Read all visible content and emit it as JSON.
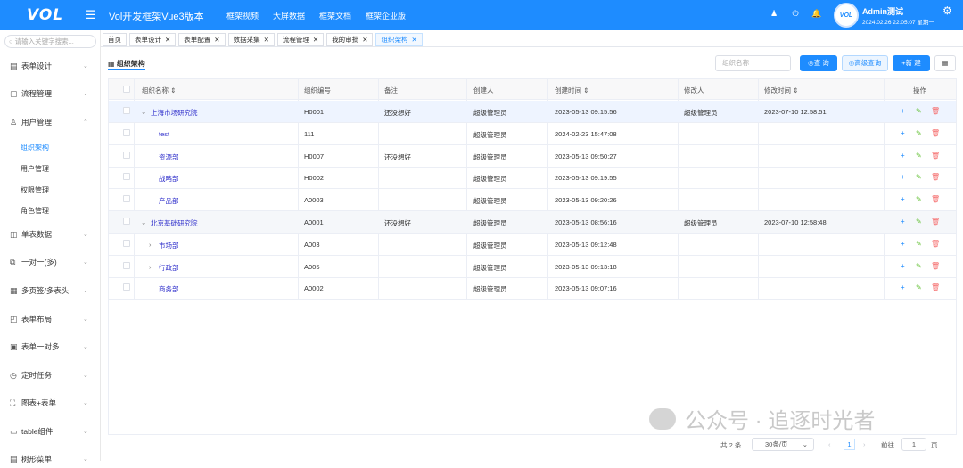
{
  "header": {
    "logo": "VOL",
    "menu_icon": "☰",
    "title": "Vol开发框架Vue3版本",
    "nav": [
      "框架视频",
      "大屏数据",
      "框架文档",
      "框架企业版"
    ],
    "icons": [
      "user-icon",
      "power-icon",
      "bell-icon"
    ],
    "icon_glyphs": [
      "♟",
      "⏻",
      "🔔"
    ],
    "avatar_text": "VOL",
    "user_name": "Admin测试",
    "user_date": "2024.02.26 22:05:07 星期一",
    "gear": "⚙"
  },
  "sidebar": {
    "search_placeholder": "请输入关键字搜索...",
    "menus": [
      {
        "label": "表单设计",
        "icon": "▤",
        "arrow": "⌄"
      },
      {
        "label": "流程管理",
        "icon": "▢",
        "arrow": "⌄"
      },
      {
        "label": "用户管理",
        "icon": "♙",
        "arrow": "⌃"
      },
      {
        "label": "单表数据",
        "icon": "◫",
        "arrow": "⌄"
      },
      {
        "label": "一对一(多)",
        "icon": "⧉",
        "arrow": "⌄"
      },
      {
        "label": "多页签/多表头",
        "icon": "▦",
        "arrow": "⌄"
      },
      {
        "label": "表单布局",
        "icon": "◰",
        "arrow": "⌄"
      },
      {
        "label": "表单一对多",
        "icon": "▣",
        "arrow": "⌄"
      },
      {
        "label": "定时任务",
        "icon": "◷",
        "arrow": "⌄"
      },
      {
        "label": "图表+表单",
        "icon": "⛶",
        "arrow": "⌄"
      },
      {
        "label": "table组件",
        "icon": "▭",
        "arrow": "⌄"
      },
      {
        "label": "树形菜单",
        "icon": "▤",
        "arrow": "⌄"
      }
    ],
    "submenu": [
      "组织架构",
      "用户管理",
      "权限管理",
      "角色管理"
    ]
  },
  "tabs": [
    {
      "label": "首页",
      "close": ""
    },
    {
      "label": "表单设计",
      "close": "✕"
    },
    {
      "label": "表单配置",
      "close": "✕"
    },
    {
      "label": "数据采集",
      "close": "✕"
    },
    {
      "label": "流程管理",
      "close": "✕"
    },
    {
      "label": "我的审批",
      "close": "✕"
    },
    {
      "label": "组织架构",
      "close": "✕"
    }
  ],
  "page": {
    "title": "▦ 组织架构",
    "search_placeholder": "组织名称",
    "btn_query": "◎查 询",
    "btn_advanced": "◎高级查询",
    "btn_new": "+新 建",
    "btn_grid": "▦"
  },
  "table": {
    "headers": [
      "组织名称 ⇕",
      "组织编号",
      "备注",
      "创建人",
      "创建时间 ⇕",
      "修改人",
      "修改时间 ⇕",
      "操作"
    ],
    "rows": [
      {
        "name": "上海市场研究院",
        "expander": "⌄",
        "code": "H0001",
        "remark": "还没想好",
        "creator": "超级管理员",
        "ctime": "2023-05-13 09:15:56",
        "modifier": "超级管理员",
        "mtime": "2023-07-10 12:58:51"
      },
      {
        "name": "test",
        "expander": "",
        "code": "111",
        "remark": "",
        "creator": "超级管理员",
        "ctime": "2024-02-23 15:47:08",
        "modifier": "",
        "mtime": ""
      },
      {
        "name": "资源部",
        "expander": "",
        "code": "H0007",
        "remark": "还没想好",
        "creator": "超级管理员",
        "ctime": "2023-05-13 09:50:27",
        "modifier": "",
        "mtime": ""
      },
      {
        "name": "战略部",
        "expander": "",
        "code": "H0002",
        "remark": "",
        "creator": "超级管理员",
        "ctime": "2023-05-13 09:19:55",
        "modifier": "",
        "mtime": ""
      },
      {
        "name": "产品部",
        "expander": "",
        "code": "A0003",
        "remark": "",
        "creator": "超级管理员",
        "ctime": "2023-05-13 09:20:26",
        "modifier": "",
        "mtime": ""
      },
      {
        "name": "北京基础研究院",
        "expander": "⌄",
        "code": "A0001",
        "remark": "还没想好",
        "creator": "超级管理员",
        "ctime": "2023-05-13 08:56:16",
        "modifier": "超级管理员",
        "mtime": "2023-07-10 12:58:48"
      },
      {
        "name": "市场部",
        "expander": "›",
        "code": "A003",
        "remark": "",
        "creator": "超级管理员",
        "ctime": "2023-05-13 09:12:48",
        "modifier": "",
        "mtime": ""
      },
      {
        "name": "行政部",
        "expander": "›",
        "code": "A005",
        "remark": "",
        "creator": "超级管理员",
        "ctime": "2023-05-13 09:13:18",
        "modifier": "",
        "mtime": ""
      },
      {
        "name": "商务部",
        "expander": "",
        "code": "A0002",
        "remark": "",
        "creator": "超级管理员",
        "ctime": "2023-05-13 09:07:16",
        "modifier": "",
        "mtime": ""
      }
    ],
    "action_glyphs": [
      "+",
      "✎",
      "🗑"
    ]
  },
  "pager": {
    "total": "共 2 条",
    "page_size": "30条/页",
    "page_size_arrow": "⌄",
    "prev": "‹",
    "current": "1",
    "next": "›",
    "goto": "前往",
    "goto_value": "1",
    "page_unit": "页"
  },
  "watermark": "公众号 · 追逐时光者"
}
